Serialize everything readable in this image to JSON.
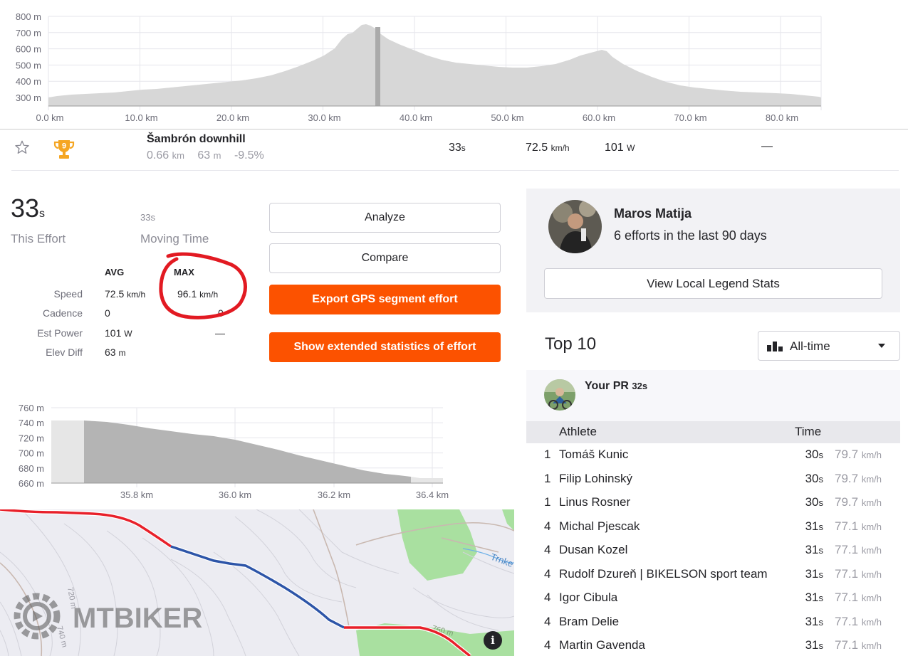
{
  "elevation_profile": {
    "y_ticks": [
      "800 m",
      "700 m",
      "600 m",
      "500 m",
      "400 m",
      "300 m"
    ],
    "x_ticks": [
      "0.0 km",
      "10.0 km",
      "20.0 km",
      "30.0 km",
      "40.0 km",
      "50.0 km",
      "60.0 km",
      "70.0 km",
      "80.0 km"
    ],
    "fill_color": "#d7d7d7",
    "highlight_color": "#aaaaaa"
  },
  "segment": {
    "name": "Šambrón downhill",
    "distance": "0.66",
    "distance_unit": "km",
    "elev": "63",
    "elev_unit": "m",
    "grade": "-9.5%",
    "time": "33",
    "time_unit": "s",
    "speed": "72.5",
    "speed_unit": "km/h",
    "power": "101",
    "power_unit": "W",
    "pr_col": "—",
    "rank_badge": "9",
    "trophy_color": "#f5a623"
  },
  "effort": {
    "elapsed": "33",
    "elapsed_unit": "s",
    "elapsed_label": "This Effort",
    "moving": "33s",
    "moving_label": "Moving Time",
    "avg_header": "AVG",
    "max_header": "MAX",
    "rows": [
      {
        "label": "Speed",
        "avg": "72.5",
        "avg_unit": "km/h",
        "max": "96.1",
        "max_unit": "km/h"
      },
      {
        "label": "Cadence",
        "avg": "0",
        "avg_unit": "",
        "max": "0",
        "max_unit": ""
      },
      {
        "label": "Est Power",
        "avg": "101",
        "avg_unit": "W",
        "max": "—",
        "max_unit": ""
      },
      {
        "label": "Elev Diff",
        "avg": "63",
        "avg_unit": "m",
        "max": "",
        "max_unit": ""
      }
    ]
  },
  "buttons": {
    "analyze": "Analyze",
    "compare": "Compare",
    "export_gps": "Export GPS segment effort",
    "extended_stats": "Show extended statistics of effort",
    "accent_color": "#fc5200"
  },
  "local_legend": {
    "name": "Maros Matija",
    "efforts": "6 efforts in the last 90 days",
    "button": "View Local Legend Stats"
  },
  "segment_profile": {
    "y_ticks": [
      "760 m",
      "740 m",
      "720 m",
      "700 m",
      "680 m",
      "660 m"
    ],
    "x_ticks": [
      "35.8 km",
      "36.0 km",
      "36.2 km",
      "36.4 km"
    ]
  },
  "map": {
    "contour_labels": [
      "720 m",
      "740 m",
      "760 m"
    ],
    "place_label": "Trnke",
    "watermark": "MTBIKER",
    "info": "i",
    "route_color": "#e8202a",
    "segment_color": "#2d55a8",
    "forest_color": "#a9e0a0"
  },
  "leaderboard": {
    "title": "Top 10",
    "filter": "All-time",
    "pr_label": "Your PR",
    "pr_time": "32s",
    "col_athlete": "Athlete",
    "col_time": "Time",
    "rows": [
      {
        "rank": "1",
        "athlete": "Tomáš Kunic",
        "time": "30",
        "speed": "79.7"
      },
      {
        "rank": "1",
        "athlete": "Filip Lohinský",
        "time": "30",
        "speed": "79.7"
      },
      {
        "rank": "1",
        "athlete": "Linus Rosner",
        "time": "30",
        "speed": "79.7"
      },
      {
        "rank": "4",
        "athlete": "Michal Pjescak",
        "time": "31",
        "speed": "77.1"
      },
      {
        "rank": "4",
        "athlete": "Dusan Kozel",
        "time": "31",
        "speed": "77.1"
      },
      {
        "rank": "4",
        "athlete": "Rudolf Dzureň | BIKELSON sport team",
        "time": "31",
        "speed": "77.1"
      },
      {
        "rank": "4",
        "athlete": "Igor Cibula",
        "time": "31",
        "speed": "77.1"
      },
      {
        "rank": "4",
        "athlete": "Bram Delie",
        "time": "31",
        "speed": "77.1"
      },
      {
        "rank": "4",
        "athlete": "Martin Gavenda",
        "time": "31",
        "speed": "77.1"
      }
    ],
    "time_unit": "s",
    "speed_unit": "km/h"
  }
}
